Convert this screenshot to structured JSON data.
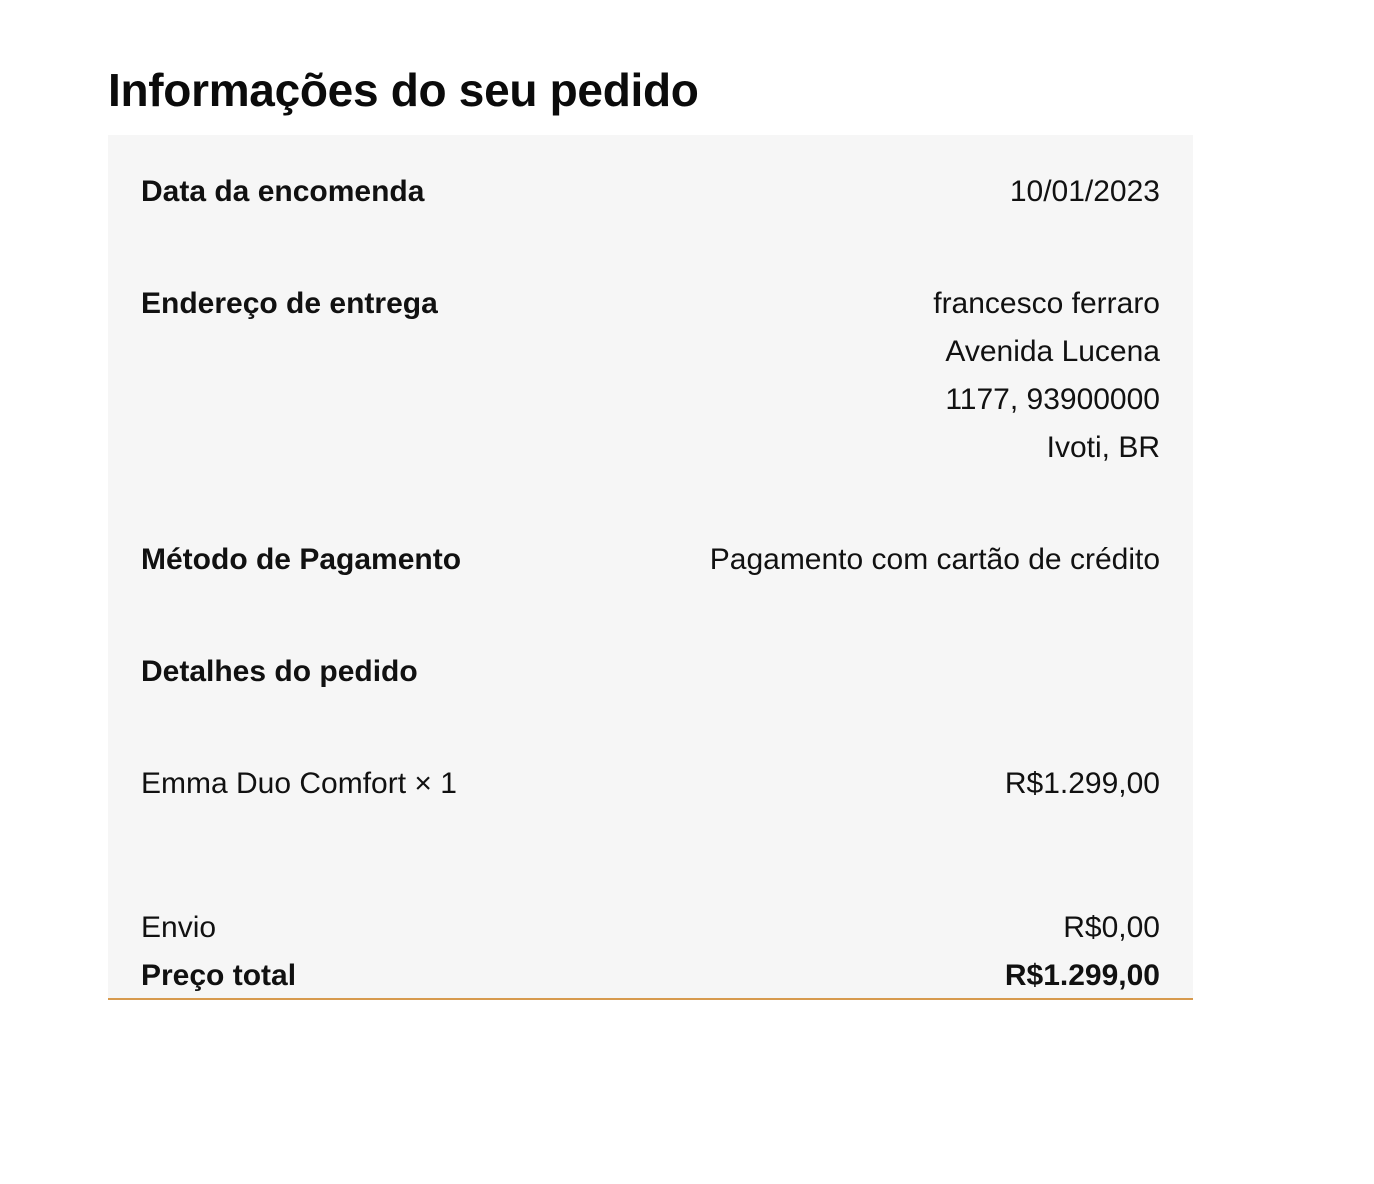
{
  "page_title": "Informações do seu pedido",
  "order": {
    "date_label": "Data da encomenda",
    "date_value": "10/01/2023",
    "address_label": "Endereço de entrega",
    "address_lines": [
      "francesco ferraro",
      "Avenida Lucena",
      "1177, 93900000",
      "Ivoti, BR"
    ],
    "payment_label": "Método de Pagamento",
    "payment_value": "Pagamento com cartão de crédito",
    "details_label": "Detalhes do pedido",
    "item_name": "Emma Duo Comfort × 1",
    "item_price": "R$1.299,00",
    "shipping_label": "Envio",
    "shipping_value": "R$0,00",
    "total_label": "Preço total",
    "total_value": "R$1.299,00"
  },
  "colors": {
    "panel_background": "#f6f6f6",
    "accent_border": "#d79a4e"
  }
}
